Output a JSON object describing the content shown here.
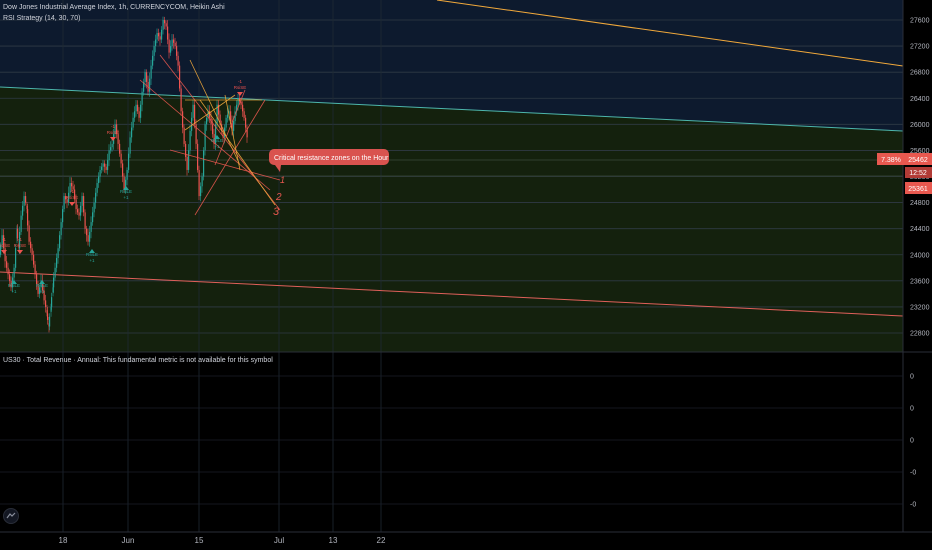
{
  "header": {
    "title": "Dow Jones Industrial Average Index, 1h, CURRENCYCOM, Heikin Ashi",
    "strategy": "RSI Strategy (14, 30, 70)"
  },
  "indicator": {
    "header": "US30 · Total Revenue · Annual: This fundamental metric is not available for this symbol",
    "axis_labels": [
      "0",
      "0",
      "0",
      "-0",
      "-0"
    ]
  },
  "annotation": {
    "text": "Critical resistance zones on the Hour"
  },
  "wave_labels": [
    "1",
    "2",
    "3"
  ],
  "price_badges": {
    "percent": "7.38%",
    "last": "25462",
    "countdown": "12:52",
    "other": "25361"
  },
  "signal_labels": {
    "long_top": "RsiLE",
    "long_bottom": "+1",
    "short_top": "-1",
    "short_bottom": "RsiSE"
  },
  "colors": {
    "background": "#000000",
    "upper_zone": "#0d1a2e",
    "lower_zone": "#14210d",
    "candle_up": "#26a69a",
    "candle_down": "#ef5350",
    "orange_line": "#f2a93b",
    "teal_line": "#4db6ac",
    "red_line": "#e0605a",
    "accent": "#e8584f"
  },
  "chart_data": {
    "type": "candlestick",
    "title": "Dow Jones Industrial Average Index, 1h, CURRENCYCOM, Heikin Ashi",
    "x_ticks": [
      "18",
      "Jun",
      "15",
      "Jul",
      "13",
      "22"
    ],
    "y_ticks": [
      22800,
      23200,
      23600,
      24000,
      24400,
      24800,
      25200,
      25600,
      26000,
      26400,
      26800,
      27200,
      27600
    ],
    "ylim": [
      22500,
      27800
    ],
    "grid": true,
    "price_path": [
      [
        0,
        24000
      ],
      [
        3,
        24300
      ],
      [
        6,
        23900
      ],
      [
        9,
        23700
      ],
      [
        12,
        23500
      ],
      [
        15,
        23800
      ],
      [
        17,
        24400
      ],
      [
        19,
        24100
      ],
      [
        22,
        24600
      ],
      [
        25,
        24900
      ],
      [
        27,
        24700
      ],
      [
        30,
        24200
      ],
      [
        33,
        24000
      ],
      [
        36,
        23700
      ],
      [
        39,
        23400
      ],
      [
        42,
        23600
      ],
      [
        45,
        23300
      ],
      [
        47,
        23100
      ],
      [
        49,
        22900
      ],
      [
        51,
        23200
      ],
      [
        53,
        23500
      ],
      [
        56,
        23800
      ],
      [
        59,
        24100
      ],
      [
        62,
        24500
      ],
      [
        65,
        24900
      ],
      [
        68,
        24800
      ],
      [
        71,
        25100
      ],
      [
        74,
        25000
      ],
      [
        77,
        24700
      ],
      [
        80,
        24600
      ],
      [
        83,
        24900
      ],
      [
        86,
        24400
      ],
      [
        89,
        24200
      ],
      [
        92,
        24500
      ],
      [
        95,
        24800
      ],
      [
        98,
        25100
      ],
      [
        101,
        25300
      ],
      [
        104,
        25400
      ],
      [
        107,
        25300
      ],
      [
        110,
        25600
      ],
      [
        113,
        25700
      ],
      [
        116,
        26000
      ],
      [
        119,
        25700
      ],
      [
        122,
        25400
      ],
      [
        125,
        25000
      ],
      [
        128,
        25300
      ],
      [
        131,
        25800
      ],
      [
        134,
        26100
      ],
      [
        137,
        26300
      ],
      [
        140,
        26100
      ],
      [
        143,
        26500
      ],
      [
        146,
        26800
      ],
      [
        149,
        26500
      ],
      [
        152,
        26900
      ],
      [
        155,
        27200
      ],
      [
        158,
        27400
      ],
      [
        161,
        27300
      ],
      [
        164,
        27600
      ],
      [
        167,
        27500
      ],
      [
        170,
        27100
      ],
      [
        173,
        27300
      ],
      [
        176,
        27200
      ],
      [
        179,
        26900
      ],
      [
        182,
        26200
      ],
      [
        185,
        25700
      ],
      [
        188,
        25300
      ],
      [
        191,
        25900
      ],
      [
        194,
        26300
      ],
      [
        197,
        25700
      ],
      [
        200,
        24900
      ],
      [
        203,
        25200
      ],
      [
        206,
        26000
      ],
      [
        209,
        26200
      ],
      [
        212,
        26000
      ],
      [
        215,
        25700
      ],
      [
        218,
        26300
      ],
      [
        221,
        26000
      ],
      [
        224,
        25800
      ],
      [
        227,
        26100
      ],
      [
        230,
        26200
      ],
      [
        233,
        25900
      ],
      [
        236,
        26200
      ],
      [
        239,
        26400
      ],
      [
        242,
        26300
      ],
      [
        245,
        26100
      ],
      [
        248,
        25800
      ]
    ],
    "annotation": "Critical resistance zones on the Hour",
    "last_price": 25462,
    "last_price_change": "7.38%",
    "other_price": 25361,
    "indicator_panel": {
      "title": "US30 · Total Revenue · Annual: This fundamental metric is not available for this symbol",
      "y_ticks": [
        "0",
        "0",
        "0",
        "-0",
        "-0"
      ]
    }
  }
}
